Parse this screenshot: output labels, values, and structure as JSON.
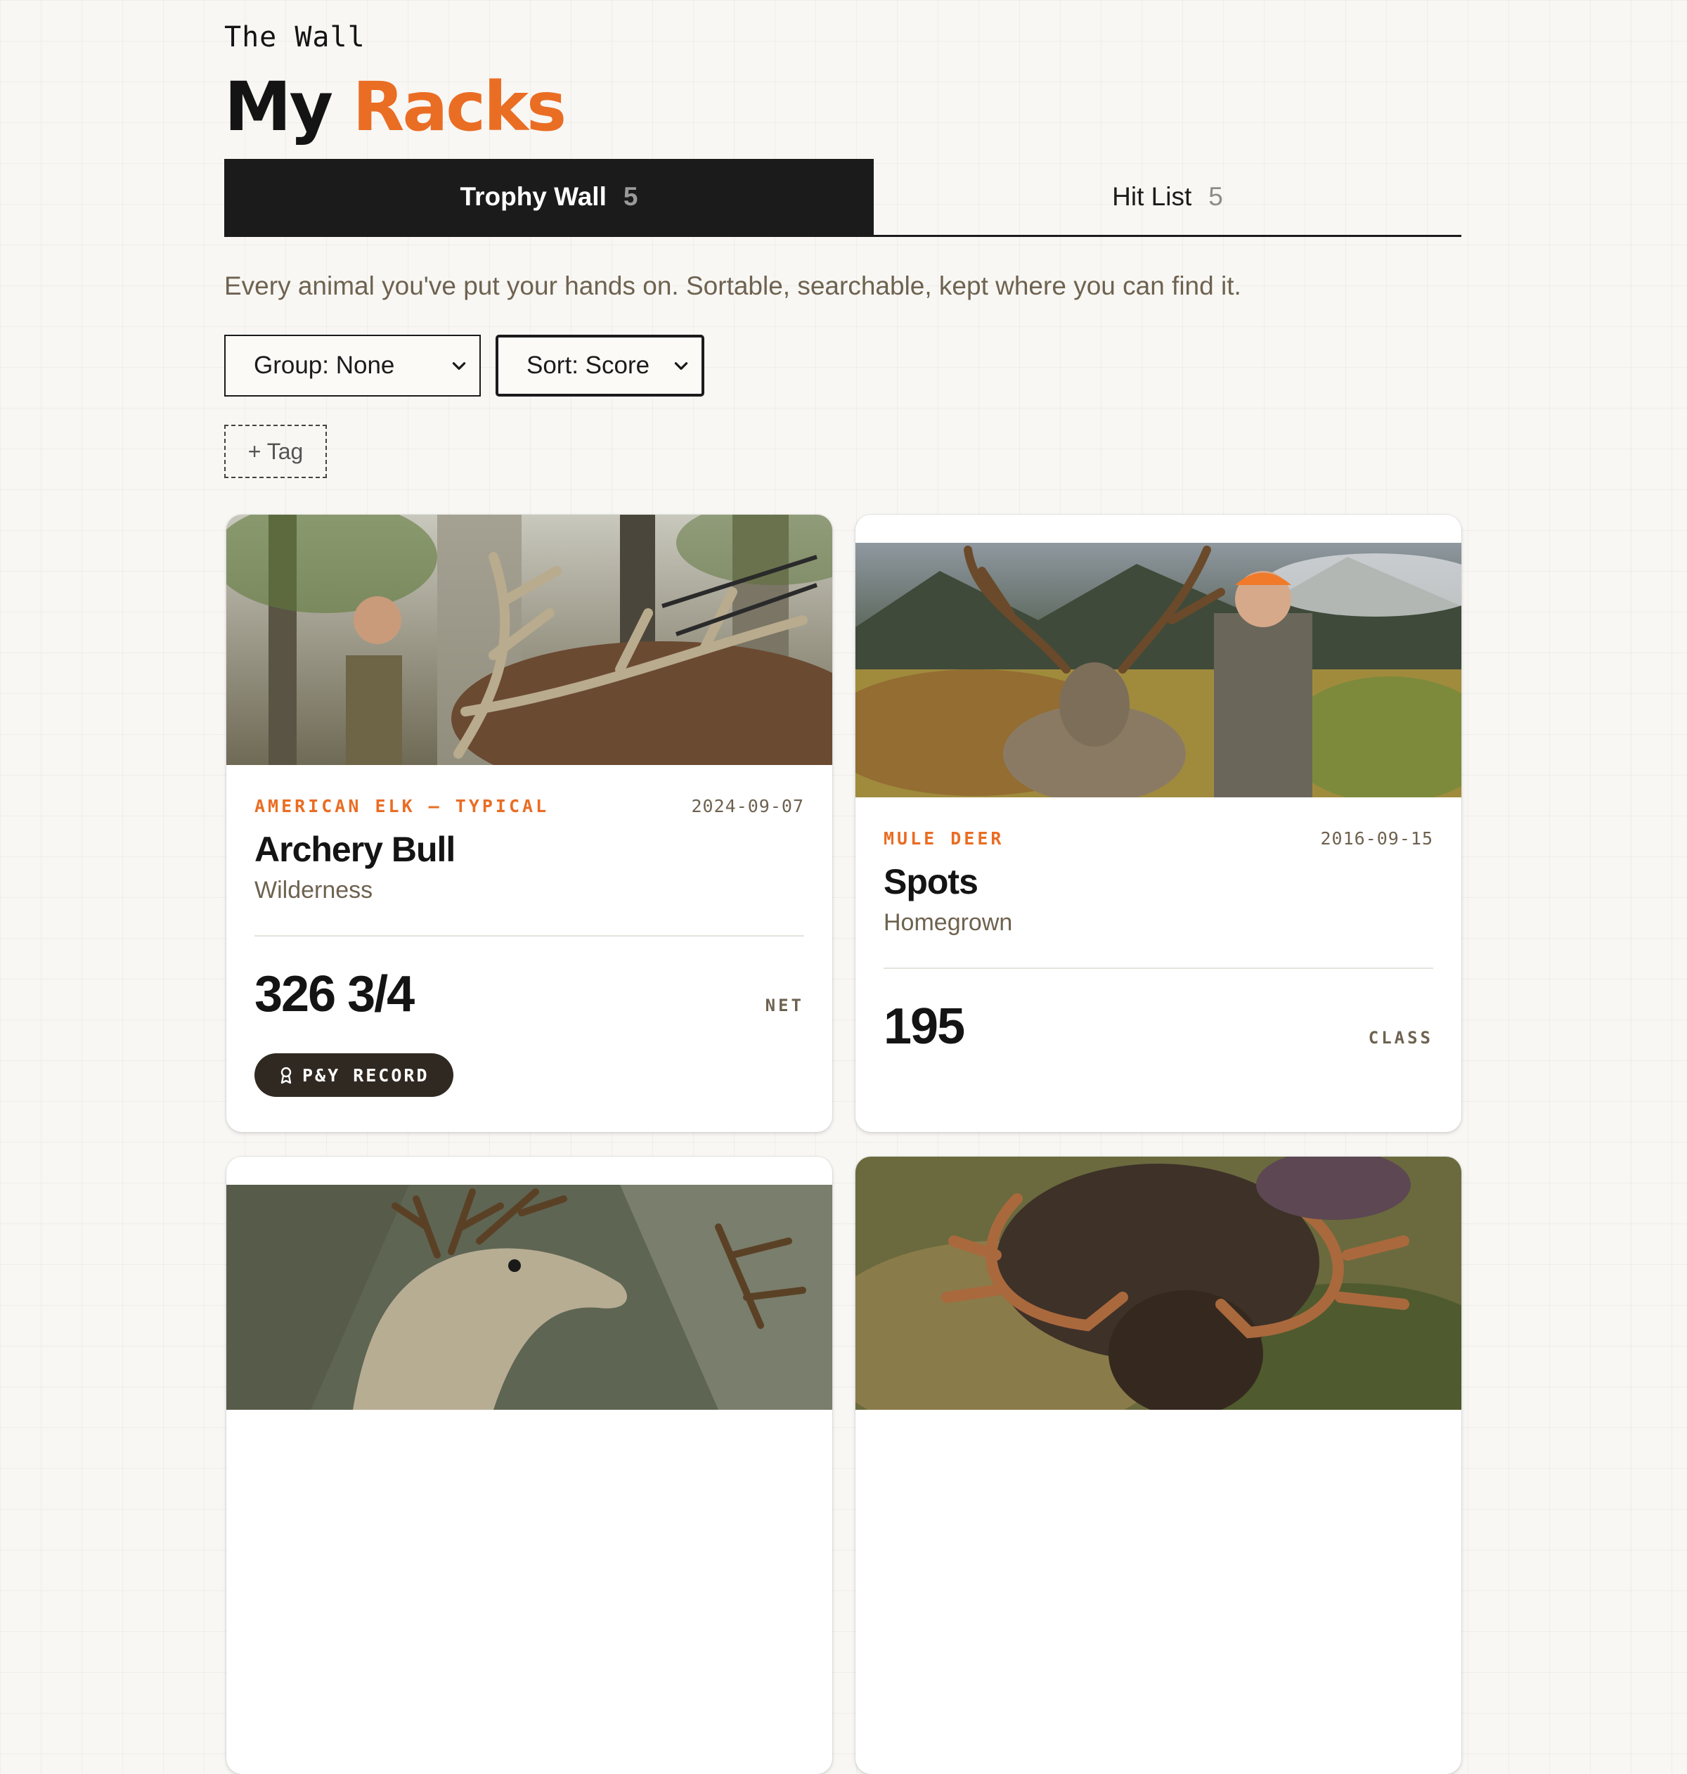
{
  "header": {
    "eyebrow": "The Wall",
    "title_prefix": "My",
    "title_accent": "Racks"
  },
  "tabs": [
    {
      "label": "Trophy Wall",
      "count": "5",
      "active": true
    },
    {
      "label": "Hit List",
      "count": "5",
      "active": false
    }
  ],
  "description": "Every animal you've put your hands on. Sortable, searchable, kept where you can find it.",
  "controls": {
    "group_select": "Group: None",
    "sort_select": "Sort: Score",
    "tag_button": "+ Tag"
  },
  "cards": [
    {
      "species": "AMERICAN ELK — TYPICAL",
      "date": "2024-09-07",
      "name": "Archery Bull",
      "location": "Wilderness",
      "score": "326 3/4",
      "score_unit": "NET",
      "badge": "P&Y RECORD",
      "photo": "elk-hunter-photo"
    },
    {
      "species": "MULE DEER",
      "date": "2016-09-15",
      "name": "Spots",
      "location": "Homegrown",
      "score": "195",
      "score_unit": "CLASS",
      "photo": "mule-deer-hunter-photo"
    },
    {
      "photo": "deer-mount-photo"
    },
    {
      "photo": "moose-photo"
    }
  ],
  "colors": {
    "accent": "#ea6d24",
    "ink": "#1b1b1b",
    "muted": "#6e6250",
    "badge_bg": "#302922"
  }
}
